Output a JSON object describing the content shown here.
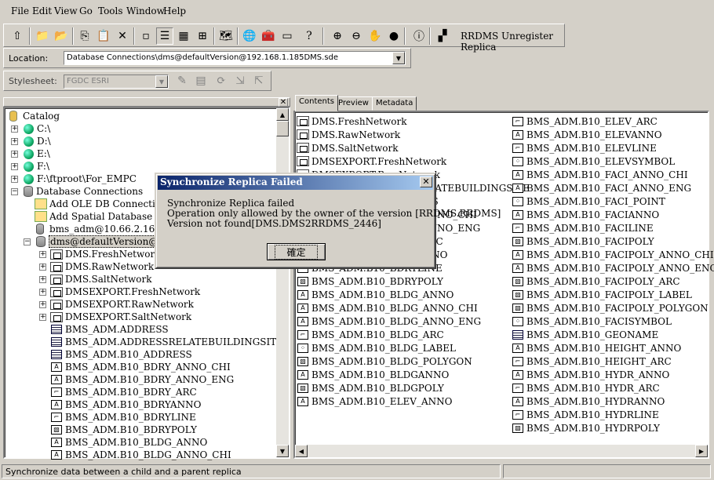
{
  "menu": [
    "File",
    "Edit",
    "View",
    "Go",
    "Tools",
    "Window",
    "Help"
  ],
  "toolbar": {
    "label": "RRDMS Unregister Replica"
  },
  "location": {
    "label": "Location:",
    "value": "Database Connections\\dms@defaultVersion@192.168.1.185DMS.sde"
  },
  "stylesheet": {
    "label": "Stylesheet:",
    "value": "FGDC ESRI"
  },
  "tree": {
    "root": "Catalog",
    "drives": [
      "C:\\",
      "D:\\",
      "E:\\",
      "F:\\",
      "F:\\ftproot\\For_EMPC"
    ],
    "db_connections": "Database Connections",
    "add_ole": "Add OLE DB Connection",
    "add_spatial": "Add Spatial Database Connection",
    "conn1": "bms_adm@10.66.2.163RR",
    "conn2": "dms@defaultVersion@192.",
    "children": [
      "DMS.FreshNetwork",
      "DMS.RawNetwork",
      "DMS.SaltNetwork",
      "DMSEXPORT.FreshNetwork",
      "DMSEXPORT.RawNetwork",
      "DMSEXPORT.SaltNetwork",
      "BMS_ADM.ADDRESS",
      "BMS_ADM.ADDRESSRELATEBUILDINGSITE",
      "BMS_ADM.B10_ADDRESS",
      "BMS_ADM.B10_BDRY_ANNO_CHI",
      "BMS_ADM.B10_BDRY_ANNO_ENG",
      "BMS_ADM.B10_BDRY_ARC",
      "BMS_ADM.B10_BDRYANNO",
      "BMS_ADM.B10_BDRYLINE",
      "BMS_ADM.B10_BDRYPOLY",
      "BMS_ADM.B10_BLDG_ANNO",
      "BMS_ADM.B10_BLDG_ANNO_CHI"
    ]
  },
  "tabs": [
    "Contents",
    "Preview",
    "Metadata"
  ],
  "contents_col1": [
    "DMS.FreshNetwork",
    "DMS.RawNetwork",
    "DMS.SaltNetwork",
    "DMSEXPORT.FreshNetwork",
    "DMSEXPORT.RawNetwork",
    "BMS_ADM.ADDRESSRELATEBUILDINGSITE",
    "BMS_ADM.B10_ADDRESS",
    "BMS_ADM.B10_BDRY_ANNO_CHI",
    "BMS_ADM.B10_BDRY_ANNO_ENG",
    "BMS_ADM.B10_BDRY_ARC",
    "BMS_ADM.B10_BDRYANNO",
    "BMS_ADM.B10_BDRYLINE",
    "BMS_ADM.B10_BDRYPOLY",
    "BMS_ADM.B10_BLDG_ANNO",
    "BMS_ADM.B10_BLDG_ANNO_CHI",
    "BMS_ADM.B10_BLDG_ANNO_ENG",
    "BMS_ADM.B10_BLDG_ARC",
    "BMS_ADM.B10_BLDG_LABEL",
    "BMS_ADM.B10_BLDG_POLYGON",
    "BMS_ADM.B10_BLDGANNO",
    "BMS_ADM.B10_BLDGPOLY",
    "BMS_ADM.B10_ELEV_ANNO"
  ],
  "contents_col2": [
    "BMS_ADM.B10_ELEV_ARC",
    "BMS_ADM.B10_ELEVANNO",
    "BMS_ADM.B10_ELEVLINE",
    "BMS_ADM.B10_ELEVSYMBOL",
    "BMS_ADM.B10_FACI_ANNO_CHI",
    "BMS_ADM.B10_FACI_ANNO_ENG",
    "BMS_ADM.B10_FACI_POINT",
    "BMS_ADM.B10_FACIANNO",
    "BMS_ADM.B10_FACILINE",
    "BMS_ADM.B10_FACIPOLY",
    "BMS_ADM.B10_FACIPOLY_ANNO_CHI",
    "BMS_ADM.B10_FACIPOLY_ANNO_ENG",
    "BMS_ADM.B10_FACIPOLY_ARC",
    "BMS_ADM.B10_FACIPOLY_LABEL",
    "BMS_ADM.B10_FACIPOLY_POLYGON",
    "BMS_ADM.B10_FACISYMBOL",
    "BMS_ADM.B10_GEONAME",
    "BMS_ADM.B10_HEIGHT_ANNO",
    "BMS_ADM.B10_HEIGHT_ARC",
    "BMS_ADM.B10_HYDR_ANNO",
    "BMS_ADM.B10_HYDR_ARC",
    "BMS_ADM.B10_HYDRANNO",
    "BMS_ADM.B10_HYDRLINE",
    "BMS_ADM.B10_HYDRPOLY"
  ],
  "dialog": {
    "title": "Synchronize Replica Failed",
    "line1": "Synchronize Replica failed",
    "line2": "Operation only allowed by the owner of the version [RRDMS.RRDMS]",
    "line3": "Version not found[DMS.DMS2RRDMS_2446]",
    "ok": "確定"
  },
  "status": "Synchronize data between a child and a parent replica"
}
